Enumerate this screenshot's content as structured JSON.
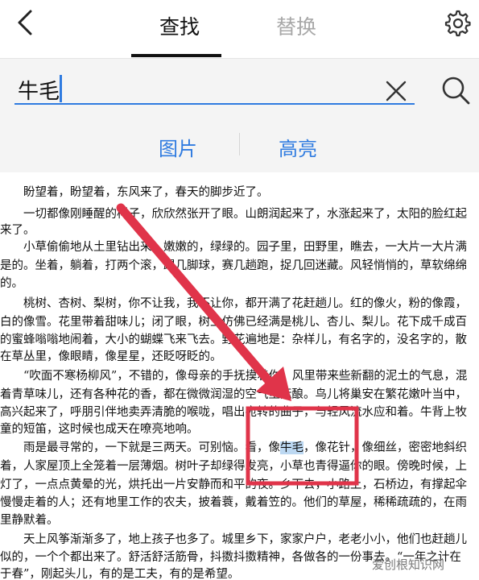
{
  "header": {
    "tab_find": "查找",
    "tab_replace": "替换",
    "back_icon": "chevron-left-icon",
    "settings_icon": "gear-icon"
  },
  "search": {
    "value": "牛毛",
    "clear_icon": "close-icon",
    "search_icon": "search-icon",
    "option_image": "图片",
    "option_highlight": "高亮"
  },
  "document": {
    "lines": [
      "　　盼望着，盼望着，东风来了，春天的脚步近了。",
      "　　一切都像刚睡醒的样子，欣欣然张开了眼。山朗润起来了，水涨起来了，太阳的脸红起",
      "来了。",
      "　　小草偷偷地从土里钻出来，嫩嫩的，绿绿的。园子里，田野里，瞧去，一大片一大片满",
      "是的。坐着，躺着，打两个滚，踢几脚球，赛几趟跑，捉几回迷藏。风轻悄悄的，草软绵绵",
      "的。",
      "　　桃树、杏树、梨树，你不让我，我不让你，都开满了花赶趟儿。红的像火，粉的像霞，",
      "白的像雪。花里带着甜味儿；闭了眼，树上仿佛已经满是桃儿、杏儿、梨儿。花下成千成百",
      "的蜜蜂嗡嗡地闹着，大小的蝴蝶飞来飞去。野花遍地是：杂样儿，有名字的，没名字的，散",
      "在草丛里，像眼睛，像星星，还眨呀眨的。",
      "　　“吹面不寒杨柳风”，不错的，像母亲的手抚摸着你。风里带来些新翻的泥土的气息，混",
      "着青草味儿，还有各种花的香，都在微微润湿的空气里酝酿。鸟儿将巢安在繁花嫩叶当中，",
      "高兴起来了，呼朋引伴地卖弄清脆的喉咙，唱出宛转的曲子，与轻风流水应和着。牛背上牧",
      "童的短笛，这时候也成天在嘹亮地响。",
      "　　雨是最寻常的，一下就是三两天。可别恼。看，像牛毛，像花针，像细丝，密密地斜织",
      "着，人家屋顶上全笼着一层薄烟。树叶子却绿得发亮，小草也青得逼你的眼。傍晚时候，上",
      "灯了，一点点黄晕的光，烘托出一片安静而和平的夜。乡下去，小路上，石桥边，有撑起伞",
      "慢慢走着的人；还有地里工作的农夫，披着蓑，戴着笠的。他们的草屋，稀稀疏疏的，在雨",
      "里静默着。",
      "　　天上风筝渐渐多了，地上孩子也多了。城里乡下，家家户户，老老小小，他们也赶趟儿",
      "似的，一个个都出来了。舒活舒活筋骨，抖擞抖擞精神，各做各的一份事去。“一年之计在",
      "于春”，刚起头儿，有的是工夫，有的是希望。"
    ],
    "match_before": "　　雨是最寻常的，一下就是三两天。可别恼。看，像",
    "match": "牛毛",
    "match_after": "，像花针，像细丝，密密地斜织"
  },
  "annotation": {
    "arrow_color": "#e0344a",
    "box_color": "#e0344a"
  },
  "watermark": "爱创根知识网"
}
